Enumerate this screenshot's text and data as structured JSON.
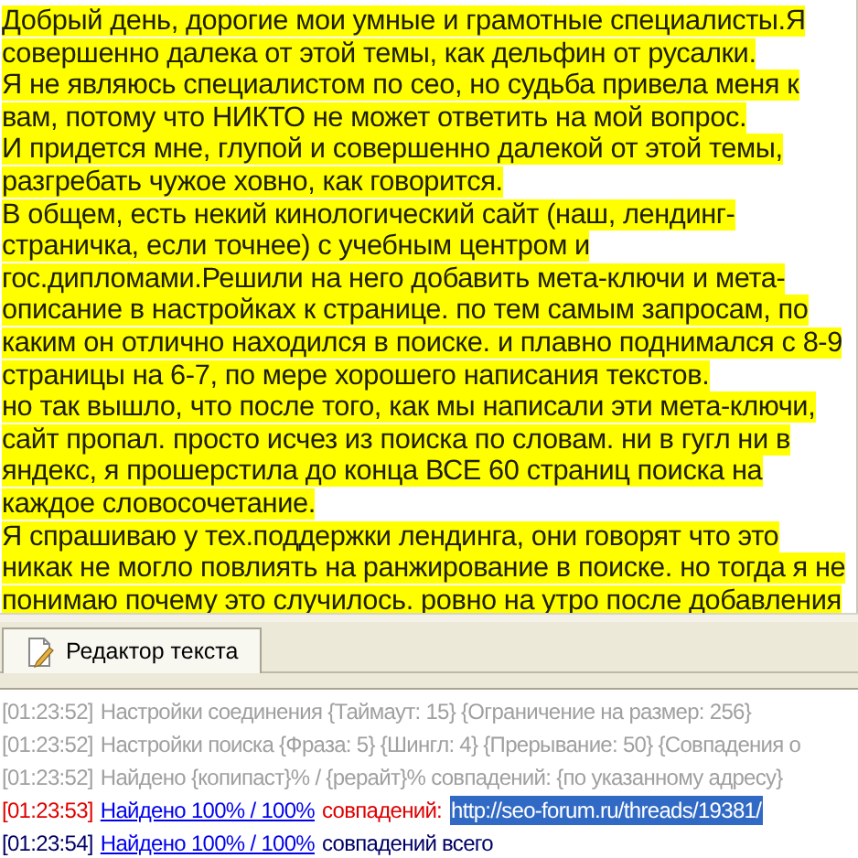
{
  "editor": {
    "lines": [
      "Добрый день, дорогие мои умные и грамотные специалисты.Я",
      "совершенно далека от этой темы, как дельфин от русалки.",
      "Я не являюсь специалистом по сео, но судьба привела меня к",
      "вам, потому что НИКТО не может ответить на мой вопрос.",
      "И придется мне, глупой и совершенно далекой от этой темы,",
      "разгребать чужое ховно, как говорится.",
      "В общем, есть некий кинологический сайт (наш, лендинг-",
      "страничка, если точнее) с учебным центром и",
      "гос.дипломами.Решили на него добавить мета-ключи и мета-",
      "описание в настройках к странице. по тем самым запросам, по",
      "каким он отлично находился в поиске. и плавно поднимался с 8-9",
      "страницы на 6-7, по мере хорошего написания текстов.",
      "но так вышло, что после того, как мы написали эти мета-ключи,",
      "сайт пропал. просто исчез из поиска по словам. ни в гугл ни в",
      "яндекс, я прошерстила до конца ВСЕ 60 страниц поиска на",
      "каждое словосочетание.",
      "Я спрашиваю у тех.поддержки лендинга, они говорят что это",
      "никак не могло повлиять на ранжирование в поиске. но тогда я не",
      "понимаю почему это случилось. ровно на утро после добавления"
    ]
  },
  "tabs": [
    {
      "label": "Редактор текста",
      "selected": true
    }
  ],
  "log": [
    {
      "time": "[01:23:52]",
      "color": "#a0a0a0",
      "parts": [
        {
          "kind": "text",
          "text": "Настройки соединения {Таймаут: 15} {Ограничение на размер: 256}"
        }
      ]
    },
    {
      "time": "[01:23:52]",
      "color": "#a0a0a0",
      "parts": [
        {
          "kind": "text",
          "text": "Настройки поиска {Фраза: 5} {Шингл: 4} {Прерывание: 50} {Совпадения о"
        }
      ]
    },
    {
      "time": "[01:23:52]",
      "color": "#a0a0a0",
      "parts": [
        {
          "kind": "text",
          "text": "Найдено {копипаст}% / {рерайт}% совпадений: {по указанному адресу}"
        }
      ]
    },
    {
      "time": "[01:23:53]",
      "color": "#e00000",
      "parts": [
        {
          "kind": "link",
          "text": "Найдено 100% / 100%"
        },
        {
          "kind": "text",
          "text": "совпадений:"
        },
        {
          "kind": "url",
          "text": "http://seo-forum.ru/threads/19381/"
        }
      ]
    },
    {
      "time": "[01:23:54]",
      "color": "#000066",
      "parts": [
        {
          "kind": "link",
          "text": "Найдено 100% / 100%"
        },
        {
          "kind": "text",
          "text": "совпадений всего"
        }
      ]
    }
  ]
}
